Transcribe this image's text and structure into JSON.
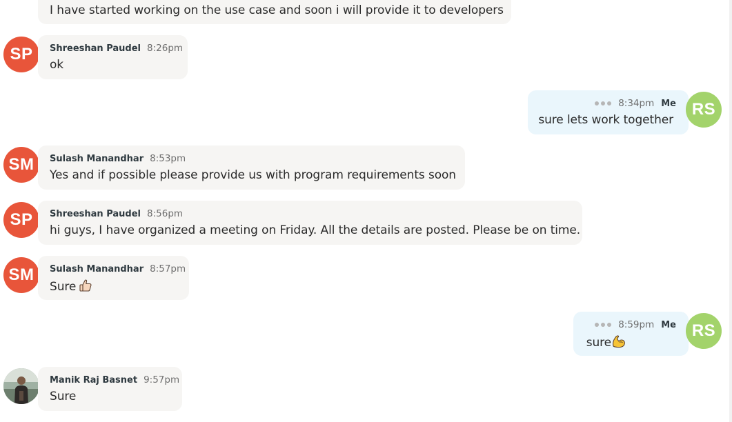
{
  "colors": {
    "incoming_bubble": "#f6f5f3",
    "outgoing_bubble": "#eaf6fc",
    "avatar_sp": "#e8553a",
    "avatar_sm": "#e8553a",
    "avatar_rs": "#a3d36b"
  },
  "messages": [
    {
      "direction": "incoming",
      "sender": "",
      "time": "",
      "text": "I have started working on the use case and soon i will provide it to developers"
    },
    {
      "direction": "incoming",
      "avatar": "SP",
      "sender": "Shreeshan Paudel",
      "time": "8:26pm",
      "text": "ok"
    },
    {
      "direction": "outgoing",
      "avatar": "RS",
      "sender": "Me",
      "time": "8:34pm",
      "text": "sure lets work together"
    },
    {
      "direction": "incoming",
      "avatar": "SM",
      "sender": "Sulash Manandhar",
      "time": "8:53pm",
      "text": "Yes and if possible please provide us with program requirements soon"
    },
    {
      "direction": "incoming",
      "avatar": "SP",
      "sender": "Shreeshan Paudel",
      "time": "8:56pm",
      "text": "hi guys, I have organized a meeting on Friday. All the details are posted. Please be on time."
    },
    {
      "direction": "incoming",
      "avatar": "SM",
      "sender": "Sulash Manandhar",
      "time": "8:57pm",
      "text": "Sure",
      "emoji": "thumbs-up-icon"
    },
    {
      "direction": "outgoing",
      "avatar": "RS",
      "sender": "Me",
      "time": "8:59pm",
      "text": "sure",
      "emoji": "flexed-biceps-icon"
    },
    {
      "direction": "incoming",
      "avatar": "photo",
      "sender": "Manik Raj Basnet",
      "time": "9:57pm",
      "text": "Sure"
    }
  ]
}
